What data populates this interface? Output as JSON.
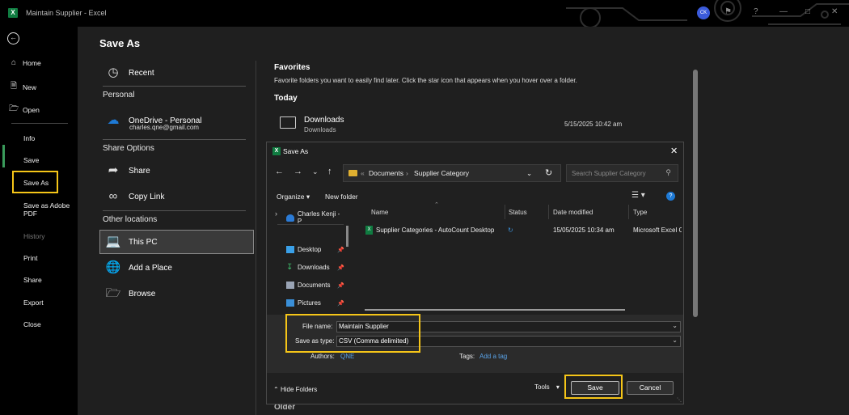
{
  "titlebar": {
    "logo": "X",
    "title": "Maintain Supplier  -  Excel",
    "avatar": "CK",
    "help": "?"
  },
  "nav": {
    "top_items": [
      {
        "label": "Home",
        "icon": "home-icon"
      },
      {
        "label": "New",
        "icon": "new-doc-icon"
      },
      {
        "label": "Open",
        "icon": "folder-open-icon"
      }
    ],
    "items": [
      "Info",
      "Save",
      "Save As",
      "Save as Adobe PDF",
      "History",
      "Print",
      "Share",
      "Export",
      "Close"
    ]
  },
  "page_title": "Save As",
  "locations": {
    "recent": "Recent",
    "personal_head": "Personal",
    "onedrive": "OneDrive - Personal",
    "onedrive_email": "charles.qne@gmail.com",
    "share_head": "Share Options",
    "share": "Share",
    "copy_link": "Copy Link",
    "other_head": "Other locations",
    "this_pc": "This PC",
    "add_place": "Add a Place",
    "browse": "Browse"
  },
  "favorites": {
    "title": "Favorites",
    "subtitle": "Favorite folders you want to easily find later. Click the star icon that appears when you hover over a folder.",
    "today": "Today",
    "older": "Older",
    "item_name": "Downloads",
    "item_sub": "Downloads",
    "item_date": "5/15/2025 10:42 am"
  },
  "dialog": {
    "logo": "X",
    "title": "Save As",
    "address": {
      "root": "«",
      "parts": [
        "Documents",
        "Supplier Category"
      ]
    },
    "search_placeholder": "Search Supplier Category",
    "organize": "Organize ▾",
    "new_folder": "New folder",
    "help": "?",
    "tree": [
      "Charles Kenji - P",
      "Desktop",
      "Downloads",
      "Documents",
      "Pictures"
    ],
    "columns": [
      "Name",
      "Status",
      "Date modified",
      "Type"
    ],
    "files": [
      {
        "name": "Supplier Categories - AutoCount Desktop",
        "status_icon": "sync-icon",
        "date": "15/05/2025 10:34 am",
        "type": "Microsoft Excel C"
      }
    ],
    "file_name_label": "File name:",
    "file_name_value": "Maintain Supplier",
    "save_type_label": "Save as type:",
    "save_type_value": "CSV (Comma delimited)",
    "authors_label": "Authors:",
    "authors_value": "QNE",
    "tags_label": "Tags:",
    "tags_value": "Add a tag",
    "hide_folders": "Hide Folders",
    "tools": "Tools",
    "save": "Save",
    "cancel": "Cancel"
  },
  "colors": {
    "highlight": "#f5c518",
    "excel_green": "#107c41",
    "link": "#5aa3e8",
    "accent": "#1e7ad6"
  }
}
